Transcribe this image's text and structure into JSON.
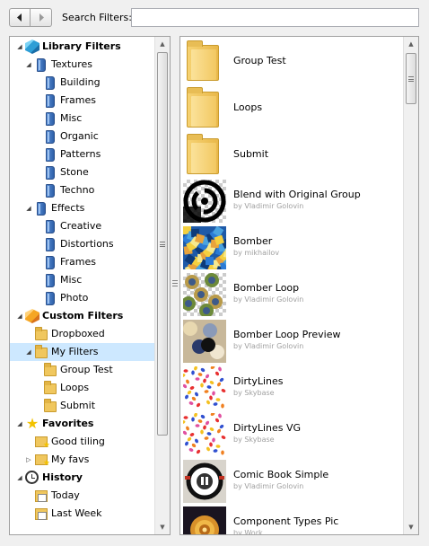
{
  "toolbar": {
    "back_icon": "arrow-left-icon",
    "forward_icon": "arrow-right-icon",
    "search_label": "Search Filters:",
    "search_value": ""
  },
  "tree": [
    {
      "label": "Library Filters",
      "bold": true,
      "icon": "cube-icon",
      "level": 0,
      "expander": "open"
    },
    {
      "label": "Textures",
      "icon": "book-icon",
      "level": 1,
      "expander": "open"
    },
    {
      "label": "Building",
      "icon": "book-icon",
      "level": 2
    },
    {
      "label": "Frames",
      "icon": "book-icon",
      "level": 2
    },
    {
      "label": "Misc",
      "icon": "book-icon",
      "level": 2
    },
    {
      "label": "Organic",
      "icon": "book-icon",
      "level": 2
    },
    {
      "label": "Patterns",
      "icon": "book-icon",
      "level": 2
    },
    {
      "label": "Stone",
      "icon": "book-icon",
      "level": 2
    },
    {
      "label": "Techno",
      "icon": "book-icon",
      "level": 2
    },
    {
      "label": "Effects",
      "icon": "book-icon",
      "level": 1,
      "expander": "open"
    },
    {
      "label": "Creative",
      "icon": "book-icon",
      "level": 2
    },
    {
      "label": "Distortions",
      "icon": "book-icon",
      "level": 2
    },
    {
      "label": "Frames",
      "icon": "book-icon",
      "level": 2
    },
    {
      "label": "Misc",
      "icon": "book-icon",
      "level": 2
    },
    {
      "label": "Photo",
      "icon": "book-icon",
      "level": 2
    },
    {
      "label": "Custom Filters",
      "bold": true,
      "icon": "cube-icon",
      "level": 0,
      "expander": "open"
    },
    {
      "label": "Dropboxed",
      "icon": "folder-icon",
      "level": 1
    },
    {
      "label": "My Filters",
      "icon": "folder-icon",
      "level": 1,
      "expander": "open",
      "selected": true
    },
    {
      "label": "Group Test",
      "icon": "folder-icon",
      "level": 2
    },
    {
      "label": "Loops",
      "icon": "folder-icon",
      "level": 2
    },
    {
      "label": "Submit",
      "icon": "folder-icon",
      "level": 2
    },
    {
      "label": "Favorites",
      "bold": true,
      "icon": "star-icon",
      "level": 0,
      "expander": "open"
    },
    {
      "label": "Good tiling",
      "icon": "favorites-folder-icon",
      "level": 1
    },
    {
      "label": "My favs",
      "icon": "favorites-folder-icon",
      "level": 1,
      "expander": "closed"
    },
    {
      "label": "History",
      "bold": true,
      "icon": "clock-icon",
      "level": 0,
      "expander": "open"
    },
    {
      "label": "Today",
      "icon": "calendar-icon",
      "level": 1
    },
    {
      "label": "Last Week",
      "icon": "calendar-icon",
      "level": 1
    }
  ],
  "list": [
    {
      "title": "Group Test",
      "author": "",
      "thumb": "folder"
    },
    {
      "title": "Loops",
      "author": "",
      "thumb": "folder"
    },
    {
      "title": "Submit",
      "author": "",
      "thumb": "folder"
    },
    {
      "title": "Blend with Original Group",
      "author": "by Vladimir Golovin",
      "thumb": "blend"
    },
    {
      "title": "Bomber",
      "author": "by mikhailov",
      "thumb": "bomber"
    },
    {
      "title": "Bomber Loop",
      "author": "by Vladimir Golovin",
      "thumb": "bomberloop"
    },
    {
      "title": "Bomber Loop Preview",
      "author": "by Vladimir Golovin",
      "thumb": "bomberpreview"
    },
    {
      "title": "DirtyLines",
      "author": "by Skybase",
      "thumb": "dirty"
    },
    {
      "title": "DirtyLines VG",
      "author": "by Skybase",
      "thumb": "dirty"
    },
    {
      "title": "Comic Book Simple",
      "author": "by Vladimir Golovin",
      "thumb": "comic"
    },
    {
      "title": "Component Types Pic",
      "author": "by Work",
      "thumb": "component"
    }
  ],
  "colors": {
    "selection": "#cde8ff",
    "author_text": "#a0a0a0",
    "folder": "#f0c75e"
  }
}
